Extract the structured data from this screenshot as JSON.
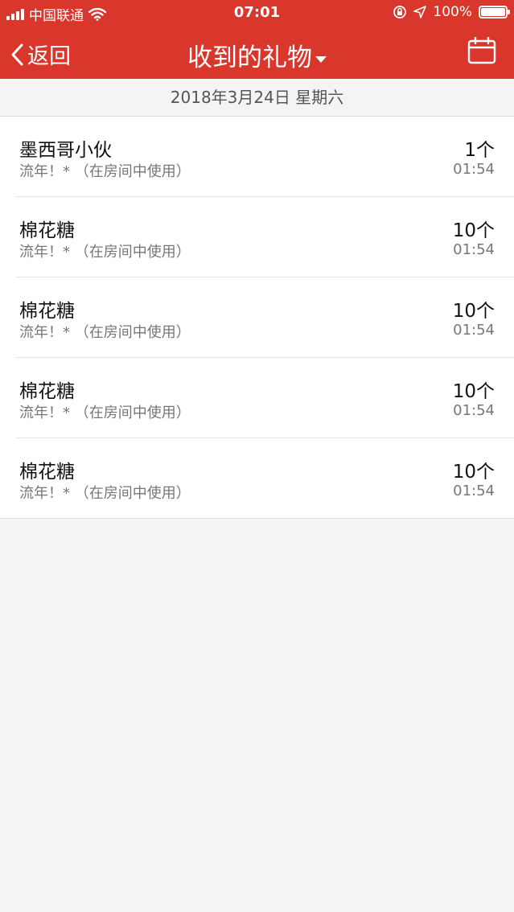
{
  "status": {
    "carrier": "中国联通",
    "time": "07:01",
    "battery": "100%"
  },
  "nav": {
    "back_label": "返回",
    "title": "收到的礼物"
  },
  "date_header": "2018年3月24日 星期六",
  "gifts": [
    {
      "name": "墨西哥小伙",
      "desc": "流年！* （在房间中使用）",
      "count": "1个",
      "time": "01:54"
    },
    {
      "name": "棉花糖",
      "desc": "流年！* （在房间中使用）",
      "count": "10个",
      "time": "01:54"
    },
    {
      "name": "棉花糖",
      "desc": "流年！* （在房间中使用）",
      "count": "10个",
      "time": "01:54"
    },
    {
      "name": "棉花糖",
      "desc": "流年！* （在房间中使用）",
      "count": "10个",
      "time": "01:54"
    },
    {
      "name": "棉花糖",
      "desc": "流年！* （在房间中使用）",
      "count": "10个",
      "time": "01:54"
    }
  ],
  "colors": {
    "brand_red": "#d9362c",
    "background": "#f4f4f4"
  },
  "icons": {
    "back": "chevron-left-icon",
    "calendar": "calendar-icon",
    "dropdown": "caret-down-icon",
    "wifi": "wifi-icon",
    "signal": "signal-icon",
    "location": "location-arrow-icon",
    "orientation_lock": "orientation-lock-icon",
    "battery": "battery-icon"
  }
}
